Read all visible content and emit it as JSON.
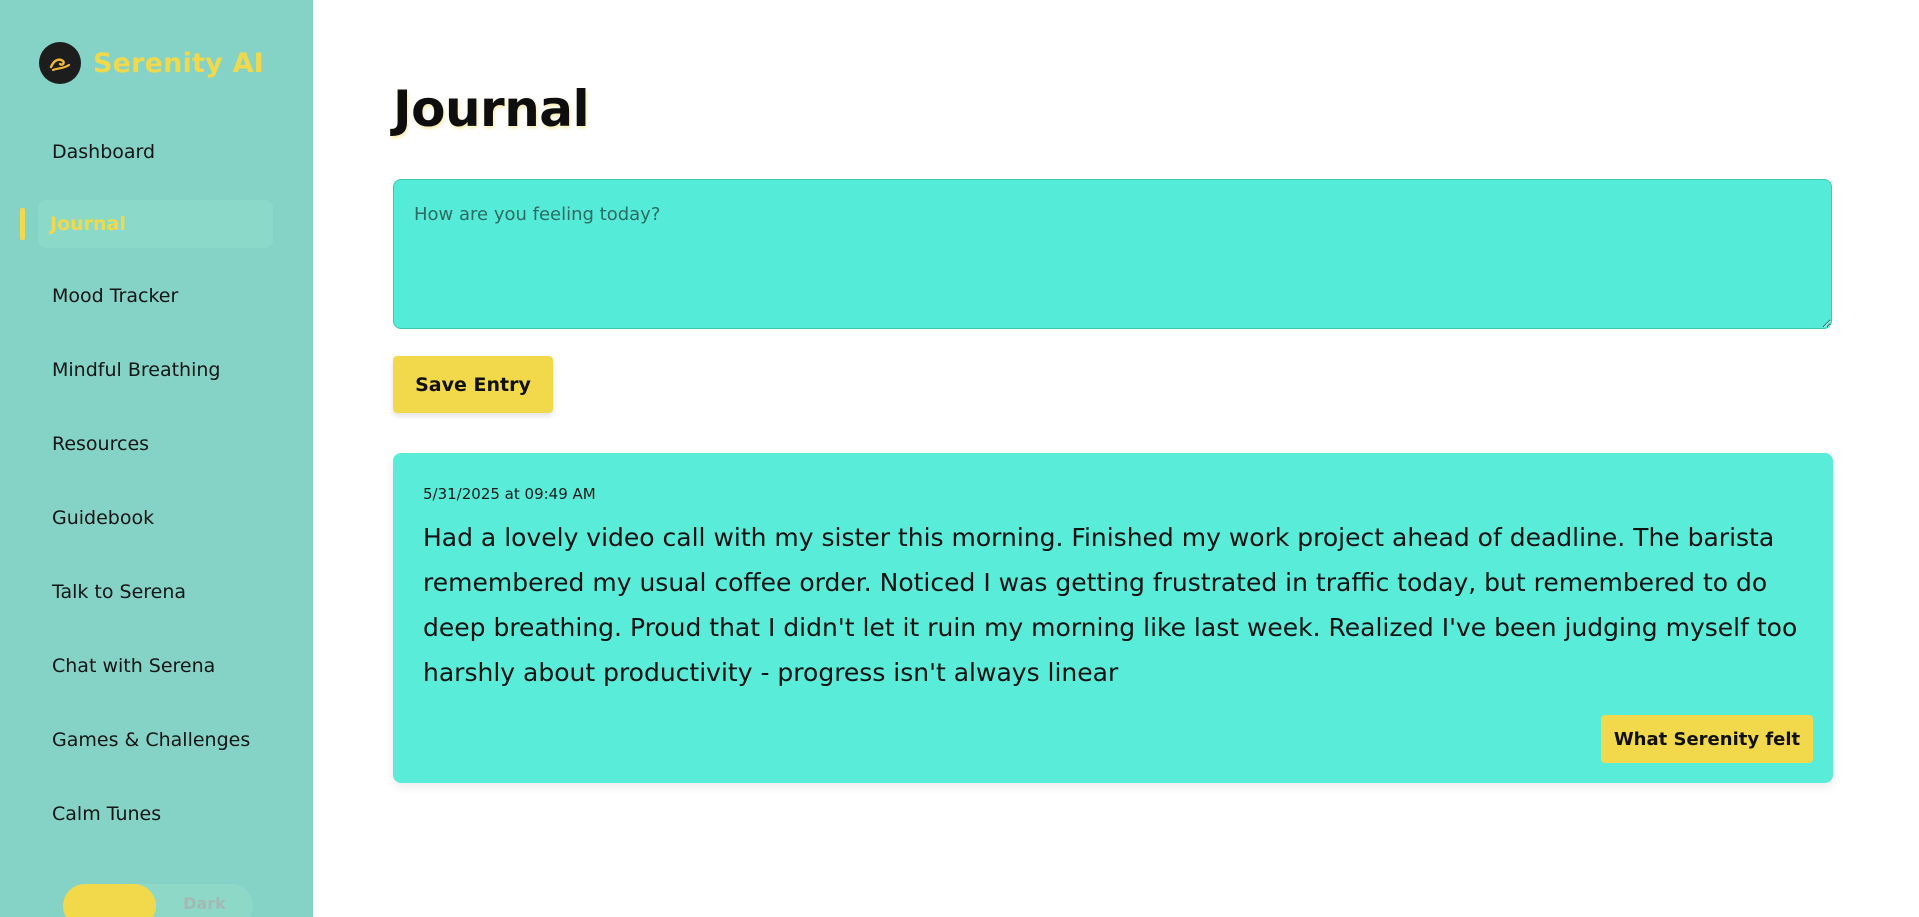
{
  "brand": {
    "name": "Serenity AI",
    "logo_icon": "wave-icon",
    "accent": "#f2d94b"
  },
  "sidebar": {
    "background": "#84d3c6",
    "items": [
      {
        "label": "Dashboard"
      },
      {
        "label": "Journal",
        "active": true
      },
      {
        "label": "Mood Tracker"
      },
      {
        "label": "Mindful Breathing"
      },
      {
        "label": "Resources"
      },
      {
        "label": "Guidebook"
      },
      {
        "label": "Talk to Serena"
      },
      {
        "label": "Chat with Serena"
      },
      {
        "label": "Games & Challenges"
      },
      {
        "label": "Calm Tunes"
      }
    ],
    "theme_toggle": {
      "light_label": "",
      "dark_label": "Dark",
      "selected": "light"
    }
  },
  "main": {
    "title": "Journal",
    "input": {
      "placeholder": "How are you feeling today?",
      "value": ""
    },
    "save_label": "Save Entry",
    "entries": [
      {
        "timestamp": "5/31/2025 at 09:49 AM",
        "text": "Had a lovely video call with my sister this morning. Finished my work project ahead of deadline. The barista remembered my usual coffee order. Noticed I was getting frustrated in traffic today, but remembered to do deep breathing. Proud that I didn't let it ruin my morning like last week. Realized I've been judging myself too harshly about productivity - progress isn't always linear",
        "action_label": "What Serenity felt"
      }
    ]
  }
}
